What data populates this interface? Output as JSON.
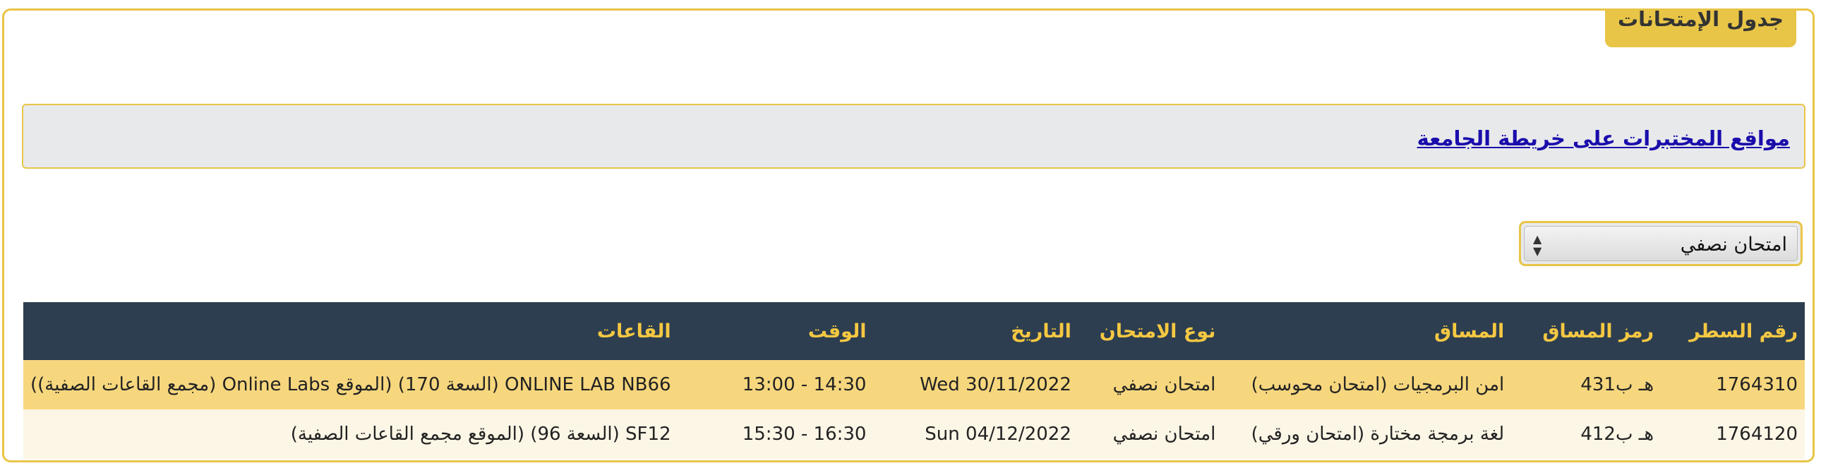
{
  "panel": {
    "title": "جدول الإمتحانات"
  },
  "map_link": {
    "label": "مواقع المختبرات على خريطة الجامعة"
  },
  "exam_type_select": {
    "selected": "امتحان نصفي"
  },
  "table": {
    "headers": [
      "رقم السطر",
      "رمز المساق",
      "المساق",
      "نوع الامتحان",
      "التاريخ",
      "الوقت",
      "القاعات"
    ],
    "rows": [
      [
        "1764310",
        "هـ ب431",
        "امن البرمجيات (امتحان محوسب)",
        "امتحان نصفي",
        "Wed 30/11/2022",
        "13:00 - 14:30",
        "ONLINE LAB NB66 (السعة 170) (الموقع Online Labs (مجمع القاعات الصفية))"
      ],
      [
        "1764120",
        "هـ ب412",
        "لغة برمجة مختارة (امتحان ورقي)",
        "امتحان نصفي",
        "Sun 04/12/2022",
        "15:30 - 16:30",
        "SF12 (السعة 96) (الموقع مجمع القاعات الصفية)"
      ]
    ]
  }
}
